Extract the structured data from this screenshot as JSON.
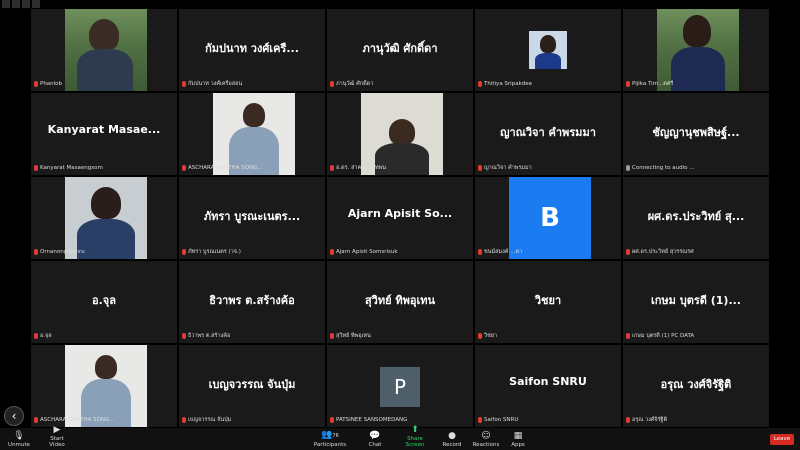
{
  "tiles": [
    {
      "name": "",
      "caption": "Phanlob"
    },
    {
      "name": "กัมปนาท วงศ์เครื...",
      "caption": "กัมปนาท วงศ์เครือสอน"
    },
    {
      "name": "ภานุวัฒิ ศักดิ์ดา",
      "caption": "ภานุวัฒิ ศักดิ์ดา"
    },
    {
      "name": "",
      "caption": "Thitiya Sripakdee"
    },
    {
      "name": "",
      "caption": "Pijika Tim...ตศรี"
    },
    {
      "name": "Kanyarat Masae...",
      "caption": "Kanyarat Masaengsom"
    },
    {
      "name": "",
      "caption": "ASCHARA NANTHA SONG..."
    },
    {
      "name": "",
      "caption": "อ.ดร. สาคร ปินเทพน"
    },
    {
      "name": "ญาณวิจา คำพรมมา",
      "caption": "ญาณวิจา คำพรมมา"
    },
    {
      "name": "ชัญญานุชพสิษฐ์...",
      "caption": "Connecting to audio ..."
    },
    {
      "name": "",
      "caption": "Ornanong@snru"
    },
    {
      "name": "ภัทรา บูรณะเนตร...",
      "caption": "ภัทรา บูรณเนตร (วจ.)"
    },
    {
      "name": "Ajarn Apisit So...",
      "caption": "Ajarn Apisit Somsrisuk"
    },
    {
      "name": "",
      "caption": "ชนม์สมงค์ ...ดา"
    },
    {
      "name": "ผศ.ดร.ประวิทย์ สุ...",
      "caption": "ผศ.ดร.ประวิทย์ สุวรรณรศ"
    },
    {
      "name": "อ.จุล",
      "caption": "อ.จุล"
    },
    {
      "name": "ธิวาพร ต.สร้างค้อ",
      "caption": "ธิวาพร ต.สร้างค้อ"
    },
    {
      "name": "สุวิทย์ ทิพอุเทน",
      "caption": "สุวิทย์ ทิพอุเทน"
    },
    {
      "name": "วิชยา",
      "caption": "วิชยา"
    },
    {
      "name": "เกษม บุตรดี (1)...",
      "caption": "เกษม บุตรดี (1) PC DATA"
    },
    {
      "name": "",
      "caption": "ASCHARA NANTHA SONG..."
    },
    {
      "name": "เบญจวรรณ จันปุ่ม",
      "caption": "เบญจวรรณ จันปุ่ม"
    },
    {
      "name": "P",
      "caption": "PATSINEE SANSOMEDANG"
    },
    {
      "name": "Saifon SNRU",
      "caption": "Saifon SNRU"
    },
    {
      "name": "อรุณ วงศ์จิรัฐิติ",
      "caption": "อรุณ วงศ์จิรัฐิติ"
    }
  ],
  "b_logo": "B",
  "toolbar": {
    "unmute": "Unmute",
    "start_video": "Start Video",
    "participants": "Participants",
    "participants_count": "76",
    "chat": "Chat",
    "share_screen": "Share Screen",
    "record": "Record",
    "reactions": "Reactions",
    "apps": "Apps",
    "leave": "Leave"
  },
  "colors": {
    "share_screen": "#2fd46a",
    "leave": "#d62b1e",
    "b_logo_bg": "#1a7cf0",
    "avatar_p": "#4f5f6a"
  }
}
